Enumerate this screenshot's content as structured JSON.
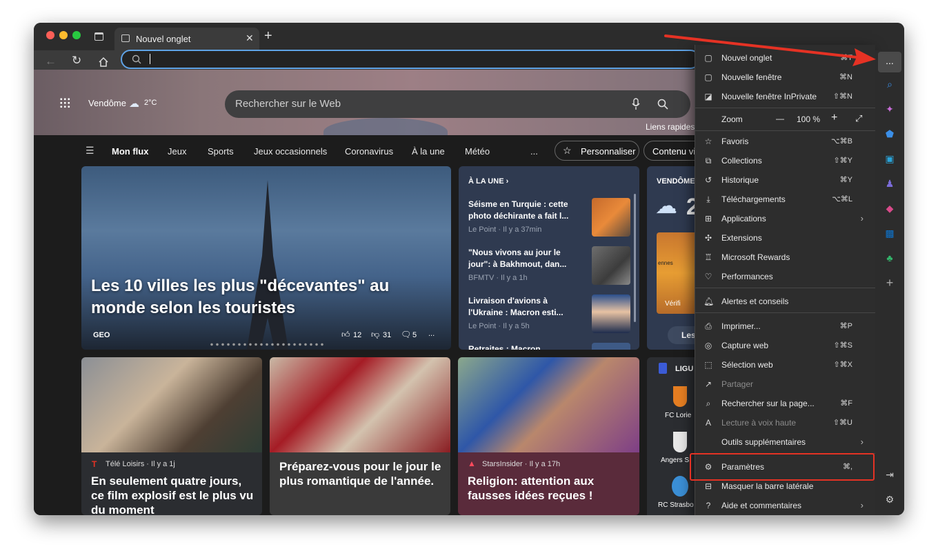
{
  "tab": {
    "title": "Nouvel onglet"
  },
  "toolbar": {
    "more": "..."
  },
  "hero": {
    "location": "Vendôme",
    "temp": "2°C",
    "search_placeholder": "Rechercher sur le Web",
    "quick_links": "Liens rapides"
  },
  "nav": [
    "Mon flux",
    "Jeux",
    "Sports",
    "Jeux occasionnels",
    "Coronavirus",
    "À la une",
    "Météo",
    "..."
  ],
  "feed_buttons": {
    "personalize": "Personnaliser",
    "content_visible": "Contenu vis"
  },
  "main_story": {
    "title": "Les 10 villes les plus \"décevantes\" au monde selon les touristes",
    "source": "GEO",
    "likes": "12",
    "dislikes": "31",
    "comments": "5",
    "more": "..."
  },
  "headlines": {
    "header": "À LA UNE ›",
    "items": [
      {
        "title": "Séisme en Turquie : cette photo déchirante a fait l...",
        "meta": "Le Point · Il y a 37min"
      },
      {
        "title": "\"Nous vivons au jour le jour\": à Bakhmout, dan...",
        "meta": "BFMTV · Il y a 1h"
      },
      {
        "title": "Livraison d'avions à l'Ukraine : Macron esti...",
        "meta": "Le Point · Il y a 5h"
      },
      {
        "title": "Retraites : Macron",
        "meta": ""
      }
    ]
  },
  "weather": {
    "header": "VENDÔME",
    "temp": "2",
    "map_label": "ennes",
    "verify": "Vérifi",
    "btn": "Les"
  },
  "cards": [
    {
      "source": "Télé Loisirs · Il y a 1j",
      "title": "En seulement quatre jours, ce film explosif est le plus vu du moment"
    },
    {
      "source": "",
      "title": "Préparez-vous pour le jour le plus romantique de l'année."
    },
    {
      "source": "StarsInsider · Il y a 17h",
      "title": "Religion: attention aux fausses idées reçues !"
    }
  ],
  "league": {
    "header": "LIGU",
    "teams": [
      "FC Lorie",
      "Angers S",
      "RC Strasbo"
    ]
  },
  "menu": {
    "items": [
      {
        "label": "Nouvel onglet",
        "shortcut": "⌘T",
        "icon": "tab-icon"
      },
      {
        "label": "Nouvelle fenêtre",
        "shortcut": "⌘N",
        "icon": "window-icon"
      },
      {
        "label": "Nouvelle fenêtre InPrivate",
        "shortcut": "⇧⌘N",
        "icon": "inprivate-icon"
      },
      {
        "label": "Favoris",
        "shortcut": "⌥⌘B",
        "icon": "star-icon"
      },
      {
        "label": "Collections",
        "shortcut": "⇧⌘Y",
        "icon": "collections-icon"
      },
      {
        "label": "Historique",
        "shortcut": "⌘Y",
        "icon": "history-icon"
      },
      {
        "label": "Téléchargements",
        "shortcut": "⌥⌘L",
        "icon": "download-icon"
      },
      {
        "label": "Applications",
        "shortcut": "",
        "icon": "apps-icon"
      },
      {
        "label": "Extensions",
        "shortcut": "",
        "icon": "puzzle-icon"
      },
      {
        "label": "Microsoft Rewards",
        "shortcut": "",
        "icon": "rewards-icon"
      },
      {
        "label": "Performances",
        "shortcut": "",
        "icon": "heartbeat-icon"
      },
      {
        "label": "Alertes et conseils",
        "shortcut": "",
        "icon": "bell-icon"
      },
      {
        "label": "Imprimer...",
        "shortcut": "⌘P",
        "icon": "print-icon"
      },
      {
        "label": "Capture web",
        "shortcut": "⇧⌘S",
        "icon": "capture-icon"
      },
      {
        "label": "Sélection web",
        "shortcut": "⇧⌘X",
        "icon": "select-icon"
      },
      {
        "label": "Partager",
        "shortcut": "",
        "icon": "share-icon"
      },
      {
        "label": "Rechercher sur la page...",
        "shortcut": "⌘F",
        "icon": "find-icon"
      },
      {
        "label": "Lecture à voix haute",
        "shortcut": "⇧⌘U",
        "icon": "read-aloud-icon"
      },
      {
        "label": "Outils supplémentaires",
        "shortcut": "",
        "icon": "more-tools-icon"
      },
      {
        "label": "Paramètres",
        "shortcut": "⌘,",
        "icon": "gear-icon"
      },
      {
        "label": "Masquer la barre latérale",
        "shortcut": "",
        "icon": "sidebar-icon"
      },
      {
        "label": "Aide et commentaires",
        "shortcut": "",
        "icon": "help-icon"
      }
    ],
    "zoom": {
      "label": "Zoom",
      "minus": "—",
      "value": "100 %",
      "plus": "+"
    }
  },
  "colors": {
    "accent": "#5fa3e6",
    "highlight": "#e53224"
  }
}
